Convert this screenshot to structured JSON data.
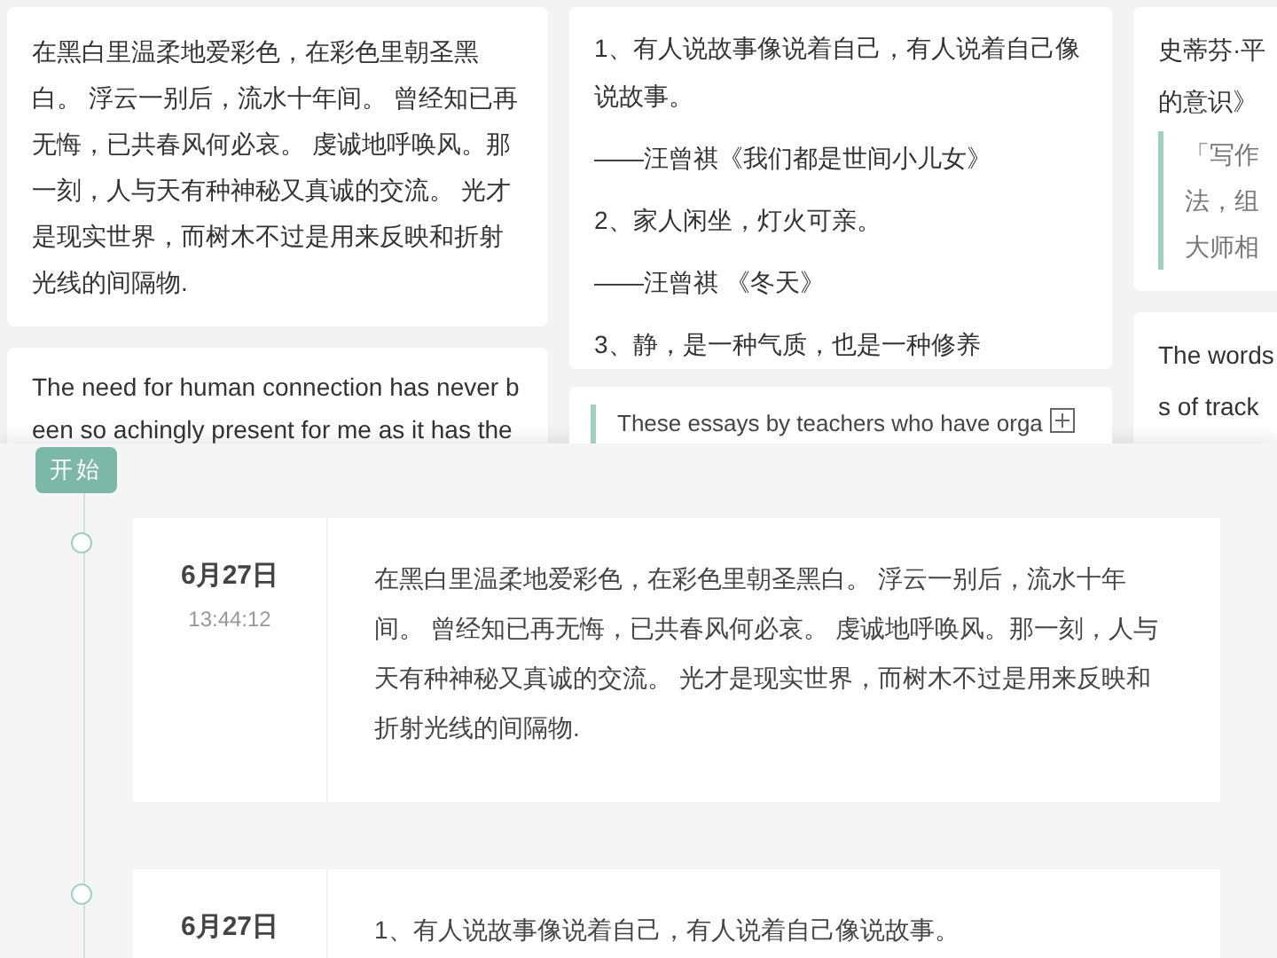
{
  "cards": {
    "column_1": [
      {
        "kind": "text",
        "lines": [
          "在黑白里温柔地爱彩色，在彩色里朝圣黑白。 浮云一别后，流水十年间。 曾经知已再无悔，已共春风何必哀。 虔诚地呼唤风。那一刻，人与天有种神秘又真诚的交流。 光才是现实世界，而树木不过是用来反映和折射光线的间隔物."
        ]
      },
      {
        "kind": "text",
        "lines": [
          "The need for human connection has never been so achingly present for me as it has the"
        ]
      }
    ],
    "column_2": [
      {
        "kind": "text",
        "lines": [
          "1、有人说故事像说着自己，有人说着自己像说故事。",
          "——汪曾祺《我们都是世间小儿女》",
          "2、家人闲坐，灯火可亲。",
          "——汪曾祺 《冬天》",
          "3、静，是一种气质，也是一种修养"
        ]
      },
      {
        "kind": "quote",
        "lines": [
          "These essays by teachers who have orga"
        ]
      }
    ],
    "column_3": [
      {
        "kind": "text",
        "lines": [
          "史蒂芬·平",
          "的意识》"
        ],
        "quote": [
          "「写作",
          "法，组",
          "大师相"
        ]
      },
      {
        "kind": "text",
        "lines": [
          "The words",
          "s of track"
        ]
      }
    ]
  },
  "timeline": {
    "start_tag": "开始",
    "entries": [
      {
        "date": "6月27日",
        "time": "13:44:12",
        "text": "在黑白里温柔地爱彩色，在彩色里朝圣黑白。 浮云一别后，流水十年间。 曾经知已再无悔，已共春风何必哀。 虔诚地呼唤风。那一刻，人与天有种神秘又真诚的交流。 光才是现实世界，而树木不过是用来反映和折射光线的间隔物."
      },
      {
        "date": "6月27日",
        "text": "1、有人说故事像说着自己，有人说着自己像说故事。"
      }
    ]
  }
}
